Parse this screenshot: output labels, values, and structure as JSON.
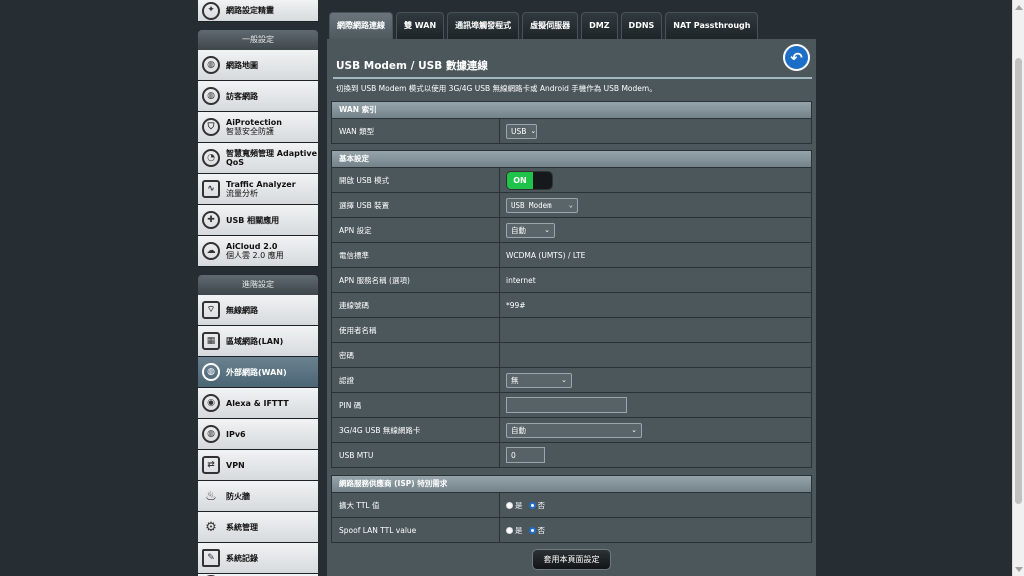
{
  "sidebar": {
    "top_item": {
      "label": "網路設定精靈"
    },
    "general_header": "一般設定",
    "general_items": [
      {
        "label": "網路地圖",
        "icon": "globe-icon"
      },
      {
        "label": "訪客網路",
        "icon": "globe-icon"
      },
      {
        "label": "AiProtection",
        "label2": "智慧安全防護",
        "icon": "shield-icon"
      },
      {
        "label": "智慧寬頻管理 Adaptive QoS",
        "icon": "speedometer-icon"
      },
      {
        "label": "Traffic Analyzer",
        "label2": "流量分析",
        "icon": "pulse-icon"
      },
      {
        "label": "USB 相關應用",
        "icon": "puzzle-icon"
      },
      {
        "label": "AiCloud 2.0",
        "label2": "個人雲 2.0 應用",
        "icon": "cloud-icon"
      }
    ],
    "advanced_header": "進階設定",
    "advanced_items": [
      {
        "label": "無線網路",
        "icon": "wifi-icon"
      },
      {
        "label": "區域網路(LAN)",
        "icon": "lan-icon"
      },
      {
        "label": "外部網路(WAN)",
        "icon": "globe-icon",
        "active": true
      },
      {
        "label": "Alexa & IFTTT",
        "icon": "assistant-icon"
      },
      {
        "label": "IPv6",
        "icon": "globe-icon"
      },
      {
        "label": "VPN",
        "icon": "vpn-icon"
      },
      {
        "label": "防火牆",
        "icon": "fire-icon"
      },
      {
        "label": "系統管理",
        "icon": "gear-icon"
      },
      {
        "label": "系統記錄",
        "icon": "document-icon"
      }
    ]
  },
  "tabs": [
    "網際網路連線",
    "雙 WAN",
    "通訊埠觸發程式",
    "虛擬伺服器",
    "DMZ",
    "DDNS",
    "NAT Passthrough"
  ],
  "panel": {
    "title": "USB Modem / USB 數據連線",
    "description": "切換到 USB Modem 模式以使用 3G/4G USB 無線網路卡或 Android 手機作為 USB Modem。",
    "wan_index": {
      "header": "WAN 索引",
      "wan_type_label": "WAN 類型",
      "wan_type_value": "USB"
    },
    "basic": {
      "header": "基本設定",
      "enable_usb_label": "開啟 USB 模式",
      "enable_usb_value": "ON",
      "select_device_label": "選擇 USB 裝置",
      "select_device_value": "USB Modem",
      "apn_config_label": "APN 設定",
      "apn_config_value": "自動",
      "telecom_label": "電信標準",
      "telecom_value": "WCDMA (UMTS) / LTE",
      "apn_name_label": "APN 服務名稱 (選項)",
      "apn_name_value": "internet",
      "dial_label": "連線號碼",
      "dial_value": "*99#",
      "username_label": "使用者名稱",
      "username_value": "",
      "password_label": "密碼",
      "password_value": "",
      "auth_label": "認證",
      "auth_value": "無",
      "pin_label": "PIN 碼",
      "pin_value": "",
      "adapter_label": "3G/4G USB 無線網路卡",
      "adapter_value": "自動",
      "mtu_label": "USB MTU",
      "mtu_value": "0"
    },
    "isp": {
      "header": "網路服務供應商 (ISP) 特別需求",
      "ttl_label": "擴大 TTL 值",
      "spoof_label": "Spoof LAN TTL value",
      "yes": "是",
      "no": "否"
    },
    "apply_label": "套用本頁面設定"
  }
}
